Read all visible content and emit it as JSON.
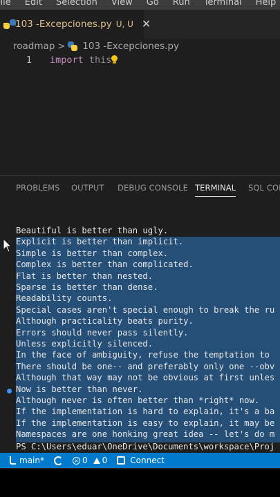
{
  "menu": [
    "File",
    "Edit",
    "Selection",
    "View",
    "Go",
    "Run",
    "Terminal",
    "Help"
  ],
  "tab": {
    "name": "103 -Excepciones.py",
    "status": "U, U",
    "close_glyph": "✕"
  },
  "breadcrumb": {
    "folder": "roadmap",
    "separator": ">",
    "file": "103 -Excepciones.py"
  },
  "editor": {
    "line_number": "1",
    "keyword": "import",
    "module": "this"
  },
  "panel_tabs": [
    "PROBLEMS",
    "OUTPUT",
    "DEBUG CONSOLE",
    "TERMINAL",
    "SQL CON"
  ],
  "active_panel_tab": "TERMINAL",
  "terminal_lines": [
    "Beautiful is better than ugly.",
    "Explicit is better than implicit.",
    "Simple is better than complex.",
    "Complex is better than complicated.",
    "Flat is better than nested.",
    "Sparse is better than dense.",
    "Readability counts.",
    "Special cases aren't special enough to break the ru",
    "Although practicality beats purity.",
    "Errors should never pass silently.",
    "Unless explicitly silenced.",
    "In the face of ambiguity, refuse the temptation to",
    "There should be one-- and preferably only one --obv",
    "Although that way may not be obvious at first unles",
    "Now is better than never.",
    "Although never is often better than *right* now.",
    "If the implementation is hard to explain, it's a ba",
    "If the implementation is easy to explain, it may be",
    "Namespaces are one honking great idea -- let's do m"
  ],
  "prompt": "PS C:\\Users\\eduar\\OneDrive\\Documents\\workspace\\Proj",
  "status_bar": {
    "branch": "main*",
    "errors": "0",
    "warnings": "0",
    "connect": "Connect"
  },
  "colors": {
    "status_bar": "#007acc",
    "selection": "#264f78",
    "keyword": "#c586c0",
    "modified_file": "#e2c08d"
  },
  "icons": [
    "python-file-icon",
    "close-icon",
    "lightbulb-icon",
    "branch-icon",
    "sync-icon",
    "error-icon",
    "warning-icon",
    "plug-icon",
    "mouse-cursor-icon"
  ]
}
